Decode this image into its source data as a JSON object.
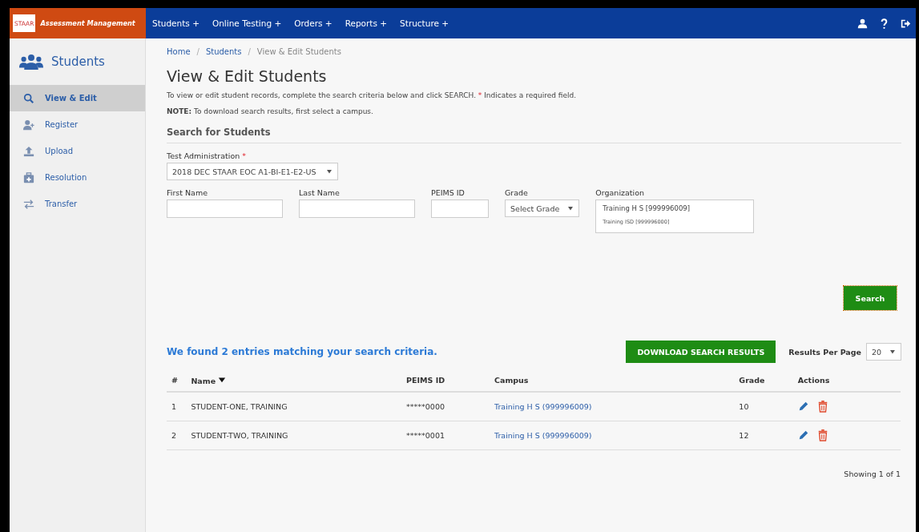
{
  "header": {
    "logo_text": "STAAR",
    "app_title": "Assessment Management",
    "menu": [
      {
        "label": "Students +"
      },
      {
        "label": "Online Testing +"
      },
      {
        "label": "Orders +"
      },
      {
        "label": "Reports +"
      },
      {
        "label": "Structure +"
      }
    ]
  },
  "sidebar": {
    "title": "Students",
    "items": [
      {
        "label": "View & Edit",
        "kind": "search",
        "selected": true
      },
      {
        "label": "Register",
        "kind": "register",
        "selected": false
      },
      {
        "label": "Upload",
        "kind": "upload",
        "selected": false
      },
      {
        "label": "Resolution",
        "kind": "resolution",
        "selected": false
      },
      {
        "label": "Transfer",
        "kind": "transfer",
        "selected": false
      }
    ]
  },
  "breadcrumb_separator": "/",
  "breadcrumb": [
    {
      "label": "Home",
      "current": false
    },
    {
      "label": "Students",
      "current": false
    },
    {
      "label": "View & Edit Students",
      "current": true
    }
  ],
  "page_title": "View & Edit Students",
  "intro": "To view or edit student records, complete the search criteria below and click SEARCH.",
  "required_mark": "*",
  "required_note": "Indicates a required field.",
  "note": "**NOTE:** To download search results, first select a campus.",
  "search_section": {
    "title": "Search for Students",
    "test_administration": {
      "label": "Test Administration",
      "required_mark": "*",
      "value": "2018 DEC STAAR EOC A1-BI-E1-E2-US"
    },
    "fields": [
      {
        "label": "First Name",
        "kind": "text"
      },
      {
        "label": "Last Name",
        "kind": "text"
      },
      {
        "label": "PEIMS ID",
        "kind": "short"
      },
      {
        "label": "Grade",
        "kind": "select",
        "value": "Select Grade"
      }
    ],
    "organization": {
      "label": "Organization",
      "selected": "Training H S [999996009]",
      "parent": "Training ISD [999996000]"
    },
    "search_button": "Search"
  },
  "results": {
    "summary": "We found 2 entries matching your search criteria.",
    "download_button": "DOWNLOAD SEARCH RESULTS",
    "per_page_label": "Results Per Page",
    "per_page_value": "20",
    "columns": [
      "#",
      "Name",
      "PEIMS ID",
      "Campus",
      "Grade",
      "Actions"
    ],
    "rows": [
      {
        "index": "1",
        "name": "STUDENT-ONE, TRAINING",
        "peims_id": "*****0000",
        "campus": "Training H S (999996009)",
        "grade": "10"
      },
      {
        "index": "2",
        "name": "STUDENT-TWO, TRAINING",
        "peims_id": "*****0001",
        "campus": "Training H S (999996009)",
        "grade": "12"
      }
    ],
    "pagination": "Showing 1 of 1"
  }
}
